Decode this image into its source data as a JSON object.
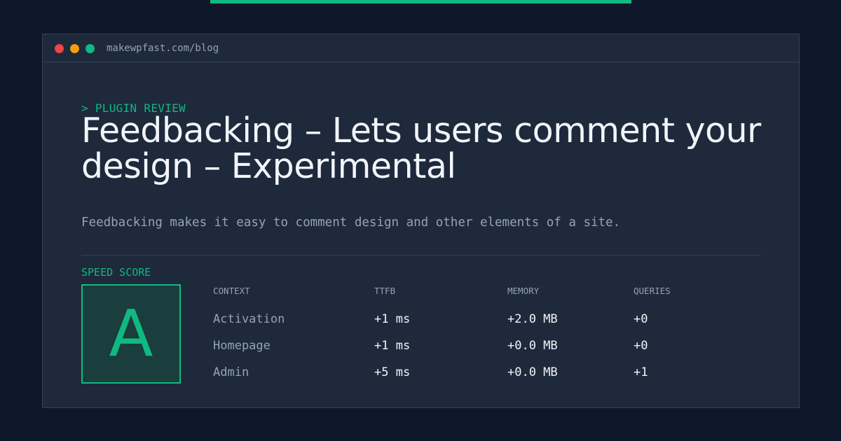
{
  "colors": {
    "accent": "#10b981",
    "background": "#0f172a",
    "panel": "#1e293b",
    "dot_red": "#ef4444",
    "dot_yellow": "#f59e0b",
    "dot_green": "#10b981"
  },
  "window": {
    "url": "makewpfast.com/blog"
  },
  "post": {
    "eyebrow": "> PLUGIN REVIEW",
    "title": "Feedbacking – Lets users comment your design – Experimental",
    "description": "Feedbacking makes it easy to comment design and other elements of a site."
  },
  "speed": {
    "label": "SPEED SCORE",
    "grade": "A"
  },
  "metrics": {
    "headers": [
      "CONTEXT",
      "TTFB",
      "MEMORY",
      "QUERIES"
    ],
    "rows": [
      [
        "Activation",
        "+1 ms",
        "+2.0 MB",
        "+0"
      ],
      [
        "Homepage",
        "+1 ms",
        "+0.0 MB",
        "+0"
      ],
      [
        "Admin",
        "+5 ms",
        "+0.0 MB",
        "+1"
      ]
    ]
  }
}
